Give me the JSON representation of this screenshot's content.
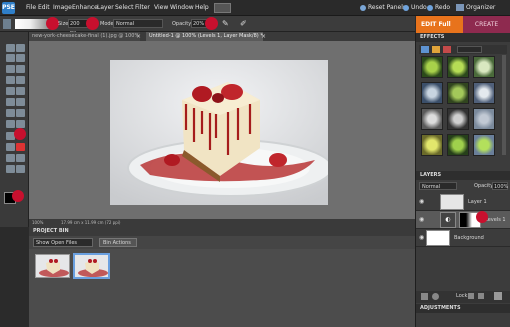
{
  "app": {
    "logo_text": "PSE"
  },
  "menu": [
    "File",
    "Edit",
    "Image",
    "Enhance",
    "Layer",
    "Select",
    "Filter",
    "View",
    "Window",
    "Help"
  ],
  "top_buttons": {
    "reset_panels": "Reset Panels",
    "undo": "Undo",
    "redo": "Redo",
    "organizer": "Organizer"
  },
  "options_bar": {
    "size_label": "Size:",
    "size_value": "200 px",
    "mode_label": "Mode:",
    "mode_value": "Normal",
    "opacity_label": "Opacity:",
    "opacity_value": "20%"
  },
  "mode_buttons": {
    "edit": "EDIT Full",
    "create": "CREATE"
  },
  "tabs": [
    {
      "label": "new-york-cheesecake-final (1).jpg @ 100% (RGB/8)"
    },
    {
      "label": "Untitled-1 @ 100% (Levels 1, Layer Mask/8) *"
    }
  ],
  "status": {
    "zoom": "100%",
    "doc": "17.99 cm x 11.99 cm (72 ppi)"
  },
  "project_bin": {
    "title": "PROJECT BIN",
    "filter": "Show Open Files",
    "actions": "Bin Actions"
  },
  "effects": {
    "title": "EFFECTS"
  },
  "layers": {
    "title": "LAYERS",
    "blend_mode": "Normal",
    "opacity_label": "Opacity:",
    "opacity_value": "100%",
    "lock_label": "Lock:",
    "items": [
      {
        "name": "Layer 1"
      },
      {
        "name": "Levels 1"
      },
      {
        "name": "Background"
      }
    ]
  },
  "adjustments": {
    "title": "ADJUSTMENTS"
  },
  "colors": {
    "accent": "#e8731c",
    "create": "#8e2a4f",
    "marker": "#c8102e"
  }
}
